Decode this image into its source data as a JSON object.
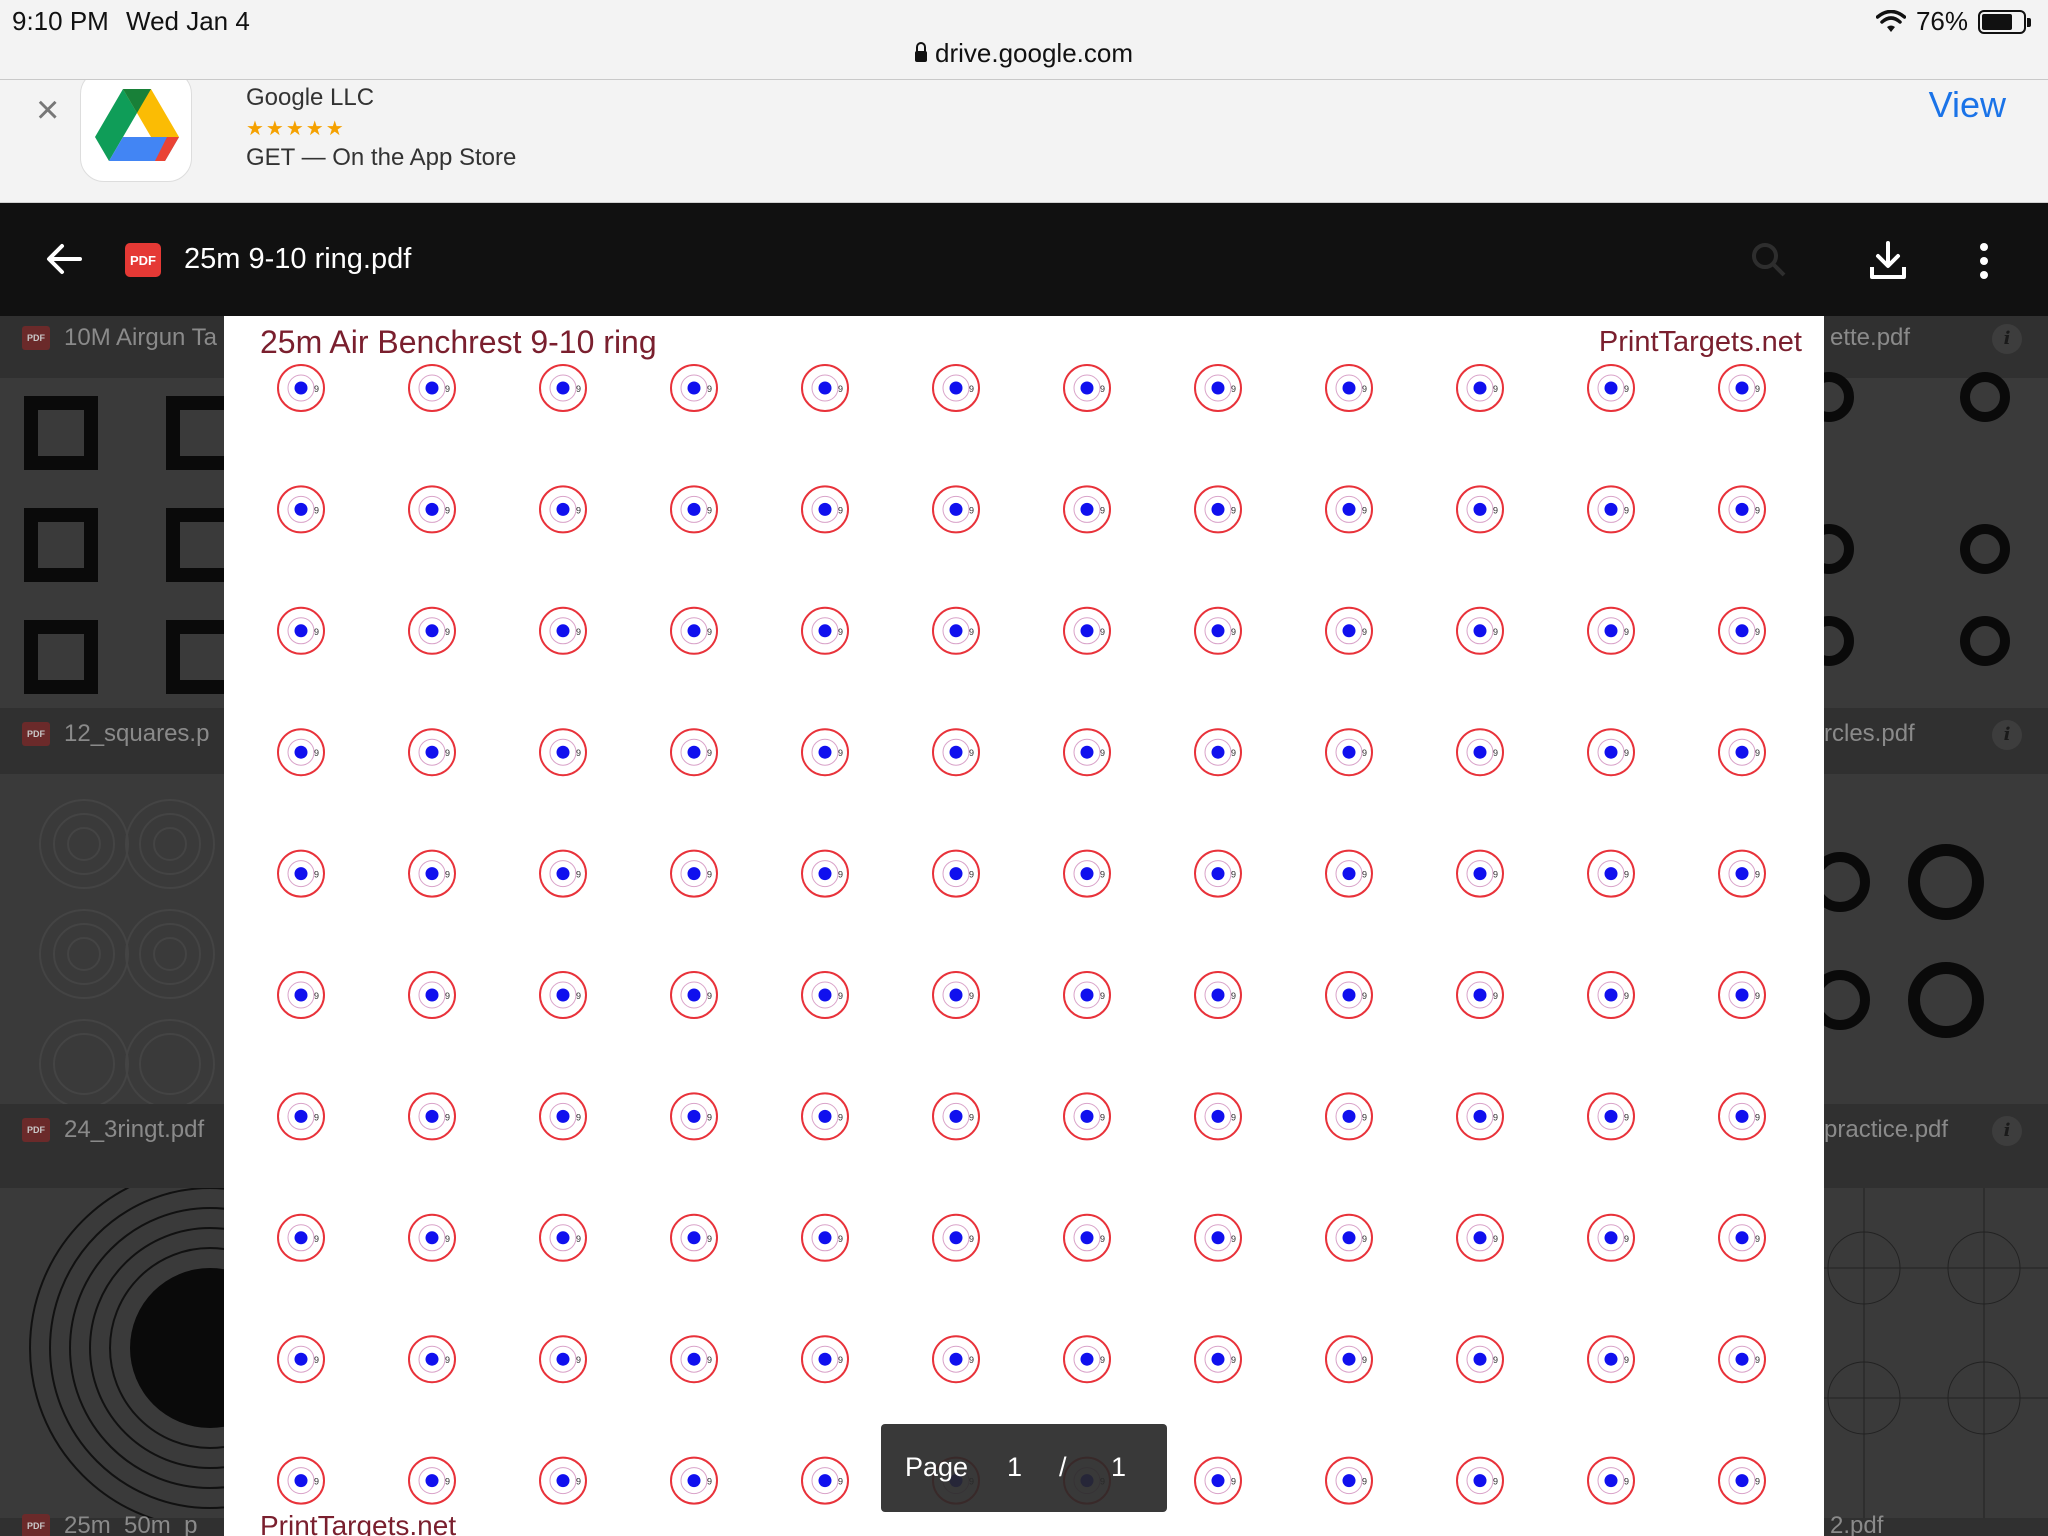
{
  "status_bar": {
    "time": "9:10 PM",
    "date": "Wed Jan 4",
    "battery": "76%",
    "battery_level": 0.76,
    "url": "drive.google.com"
  },
  "app_banner": {
    "publisher": "Google LLC",
    "rating": "★★★★★",
    "cta": "GET — On the App Store",
    "view_label": "View"
  },
  "viewer": {
    "file_badge": "PDF",
    "file_name": "25m 9-10 ring.pdf"
  },
  "background_files": [
    {
      "name": "10M Airgun Ta"
    },
    {
      "name": "ette.pdf"
    },
    {
      "name": "12_squares.p"
    },
    {
      "name": "rcles.pdf"
    },
    {
      "name": "24_3ringt.pdf"
    },
    {
      "name": "practice.pdf"
    },
    {
      "name": "25m_50m_p"
    },
    {
      "name": "2.pdf"
    }
  ],
  "pdf": {
    "title": "25m Air Benchrest 9-10 ring",
    "site": "PrintTargets.net",
    "footer": "PrintTargets.net",
    "target_label": "9",
    "target_colors": {
      "ring": "#e8323a",
      "center": "#1010ee"
    },
    "grid": {
      "rows": 10,
      "cols": 12
    }
  },
  "page_indicator": {
    "label": "Page",
    "current": "1",
    "separator": "/",
    "total": "1"
  }
}
